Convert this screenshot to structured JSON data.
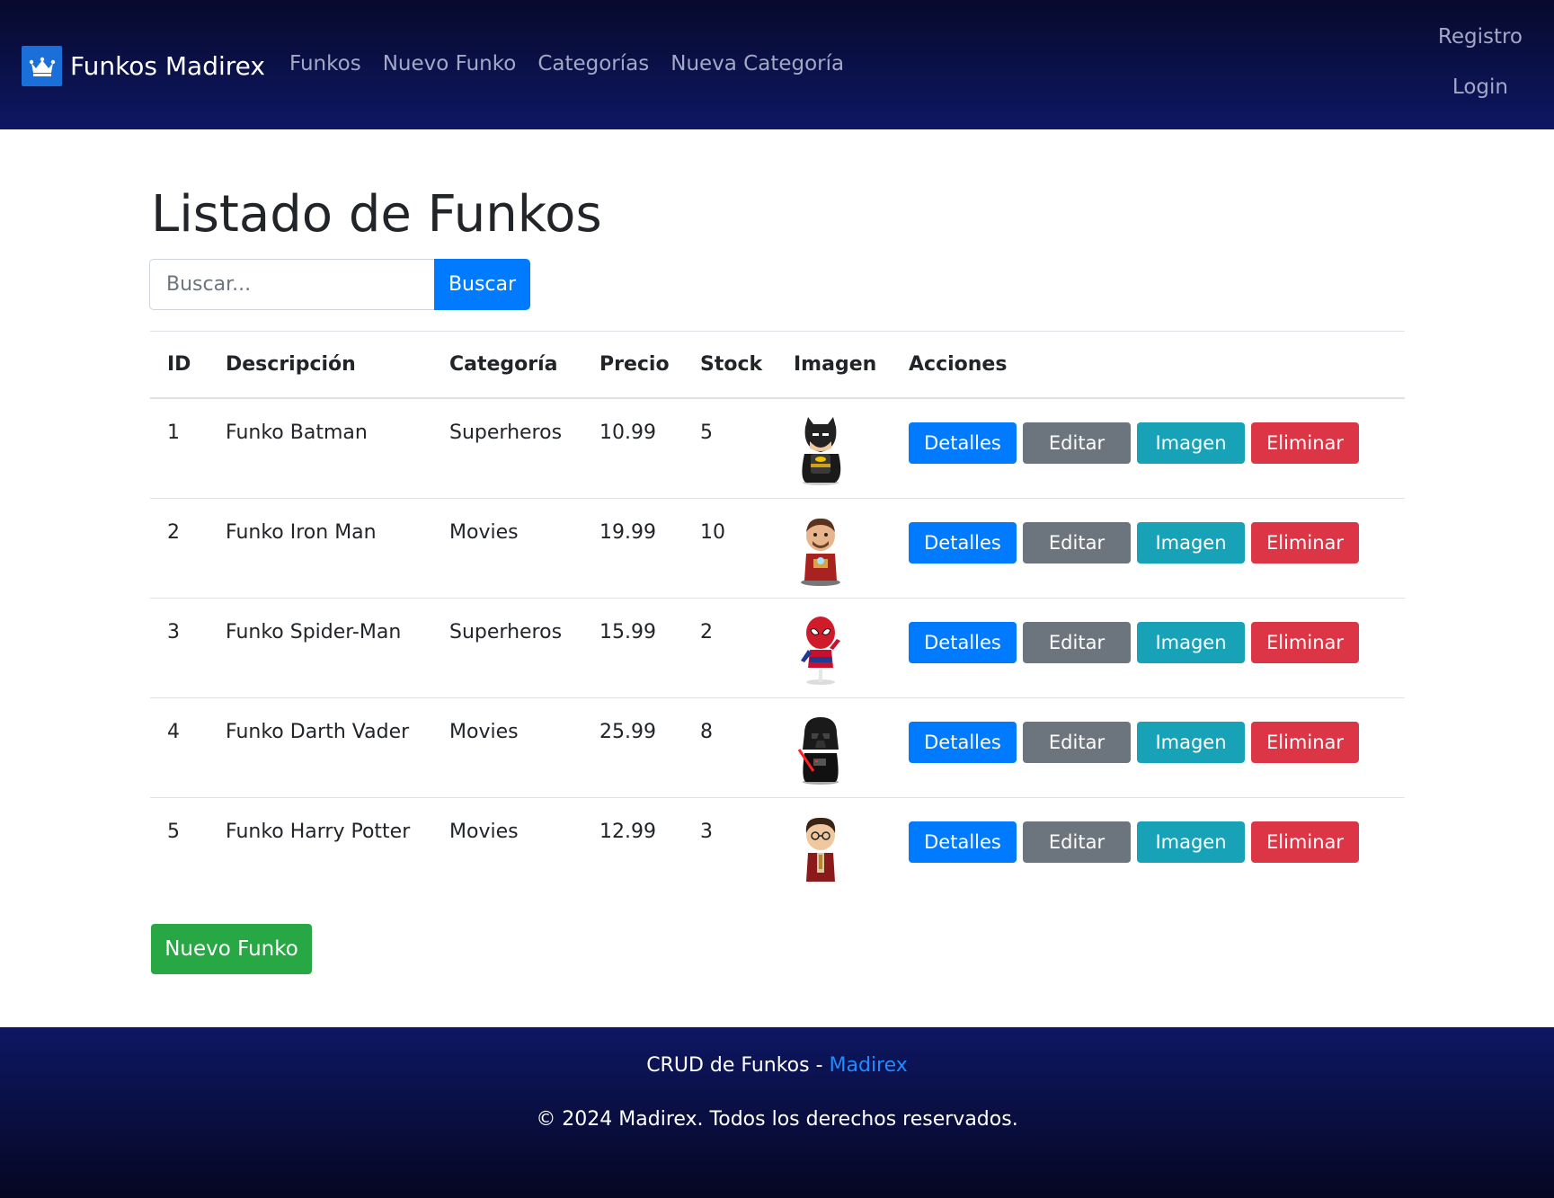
{
  "navbar": {
    "brand": "Funkos Madirex",
    "links": [
      "Funkos",
      "Nuevo Funko",
      "Categorías",
      "Nueva Categoría"
    ],
    "right_links": [
      "Registro",
      "Login"
    ]
  },
  "main": {
    "title": "Listado de Funkos",
    "search": {
      "placeholder": "Buscar...",
      "button": "Buscar"
    },
    "table": {
      "headers": [
        "ID",
        "Descripción",
        "Categoría",
        "Precio",
        "Stock",
        "Imagen",
        "Acciones"
      ],
      "rows": [
        {
          "id": "1",
          "description": "Funko Batman",
          "category": "Superheros",
          "price": "10.99",
          "stock": "5",
          "image": "batman-funko-image"
        },
        {
          "id": "2",
          "description": "Funko Iron Man",
          "category": "Movies",
          "price": "19.99",
          "stock": "10",
          "image": "iron-man-funko-image"
        },
        {
          "id": "3",
          "description": "Funko Spider-Man",
          "category": "Superheros",
          "price": "15.99",
          "stock": "2",
          "image": "spider-man-funko-image"
        },
        {
          "id": "4",
          "description": "Funko Darth Vader",
          "category": "Movies",
          "price": "25.99",
          "stock": "8",
          "image": "darth-vader-funko-image"
        },
        {
          "id": "5",
          "description": "Funko Harry Potter",
          "category": "Movies",
          "price": "12.99",
          "stock": "3",
          "image": "harry-potter-funko-image"
        }
      ],
      "actions": {
        "details": "Detalles",
        "edit": "Editar",
        "image": "Imagen",
        "delete": "Eliminar"
      }
    },
    "new_button": "Nuevo Funko"
  },
  "footer": {
    "line1_prefix": "CRUD de Funkos - ",
    "line1_link": "Madirex",
    "line2": "© 2024 Madirex. Todos los derechos reservados."
  },
  "colors": {
    "primary": "#007bff",
    "secondary": "#6c757d",
    "info": "#17a2b8",
    "danger": "#dc3545",
    "success": "#28a745",
    "navbar": "#0e1763"
  }
}
